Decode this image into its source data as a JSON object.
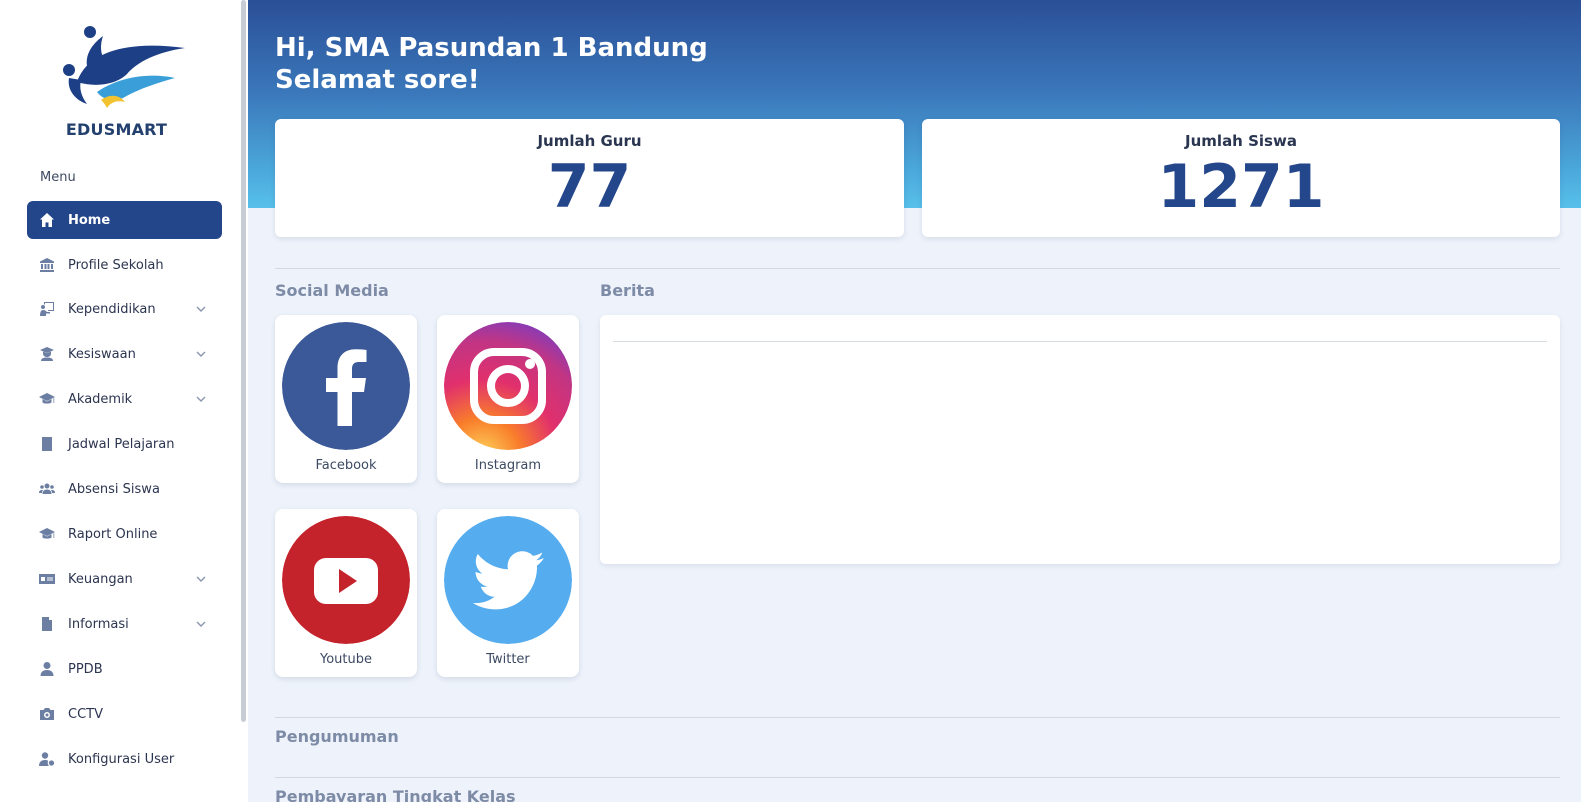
{
  "sidebar": {
    "brand": "EDUSMART",
    "menu_heading": "Menu",
    "items": [
      {
        "label": "Home",
        "icon": "home-icon",
        "active": true,
        "has_submenu": false
      },
      {
        "label": "Profile Sekolah",
        "icon": "bank-icon",
        "active": false,
        "has_submenu": false
      },
      {
        "label": "Kependidikan",
        "icon": "teacher-board-icon",
        "active": false,
        "has_submenu": true
      },
      {
        "label": "Kesiswaan",
        "icon": "student-icon",
        "active": false,
        "has_submenu": true
      },
      {
        "label": "Akademik",
        "icon": "graduation-cap-icon",
        "active": false,
        "has_submenu": true
      },
      {
        "label": "Jadwal Pelajaran",
        "icon": "book-icon",
        "active": false,
        "has_submenu": false
      },
      {
        "label": "Absensi Siswa",
        "icon": "users-icon",
        "active": false,
        "has_submenu": false
      },
      {
        "label": "Raport Online",
        "icon": "graduation-cap-icon",
        "active": false,
        "has_submenu": false
      },
      {
        "label": "Keuangan",
        "icon": "money-card-icon",
        "active": false,
        "has_submenu": true
      },
      {
        "label": "Informasi",
        "icon": "document-icon",
        "active": false,
        "has_submenu": true
      },
      {
        "label": "PPDB",
        "icon": "user-icon",
        "active": false,
        "has_submenu": false
      },
      {
        "label": "CCTV",
        "icon": "camera-icon",
        "active": false,
        "has_submenu": false
      },
      {
        "label": "Konfigurasi User",
        "icon": "user-gear-icon",
        "active": false,
        "has_submenu": false
      }
    ]
  },
  "header": {
    "greeting_line1": "Hi, SMA Pasundan 1 Bandung",
    "greeting_line2": "Selamat sore!"
  },
  "stats": {
    "teachers": {
      "label": "Jumlah Guru",
      "value": "77"
    },
    "students": {
      "label": "Jumlah Siswa",
      "value": "1271"
    }
  },
  "social": {
    "title": "Social Media",
    "items": [
      {
        "label": "Facebook",
        "icon": "facebook-icon",
        "color": "#3b5998"
      },
      {
        "label": "Instagram",
        "icon": "instagram-icon",
        "color": "#e1306c"
      },
      {
        "label": "Youtube",
        "icon": "youtube-icon",
        "color": "#c4302b"
      },
      {
        "label": "Twitter",
        "icon": "twitter-icon",
        "color": "#55acee"
      }
    ]
  },
  "news": {
    "title": "Berita"
  },
  "announcements": {
    "title": "Pengumuman"
  },
  "next_section": {
    "title": "Pembayaran Tingkat Kelas"
  },
  "colors": {
    "primary": "#23468b",
    "hero_top": "#2a4f97",
    "hero_bottom": "#57c0ea",
    "background": "#eef3fb"
  }
}
